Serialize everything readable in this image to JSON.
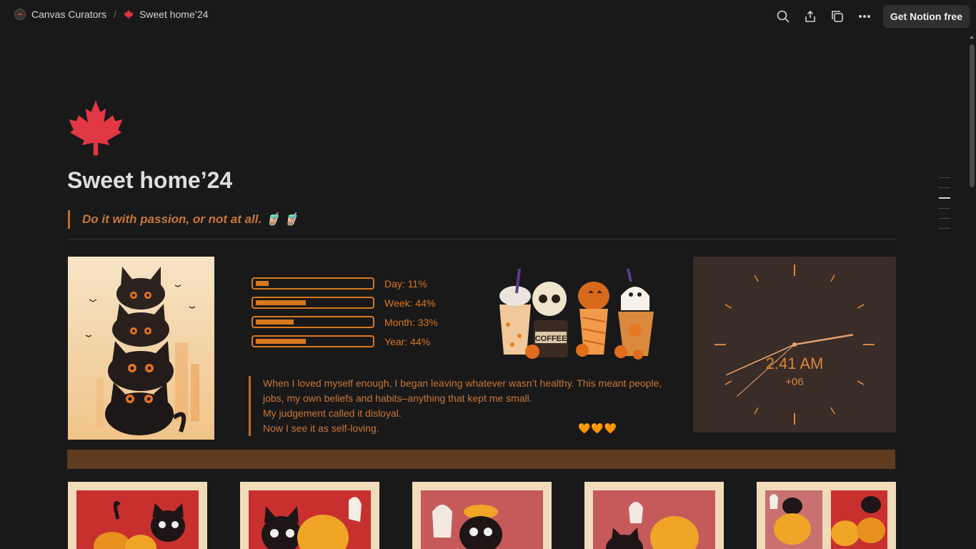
{
  "breadcrumb": {
    "workspace": "Canvas Curators",
    "separator": "/",
    "page": "Sweet home’24"
  },
  "topbar": {
    "icons": [
      "search-icon",
      "share-icon",
      "duplicate-icon",
      "more-icon"
    ],
    "get_button": "Get Notion free"
  },
  "page": {
    "title": "Sweet home’24",
    "quote": "Do it with passion, or not at all. 🧋 🧋"
  },
  "progress": [
    {
      "label": "Day: 11%",
      "value": 0.11
    },
    {
      "label": "Week: 44%",
      "value": 0.44
    },
    {
      "label": "Month: 33%",
      "value": 0.33
    },
    {
      "label": "Year: 44%",
      "value": 0.44
    }
  ],
  "reflection": {
    "lines": [
      "When I loved myself enough, I began leaving whatever wasn’t healthy. This meant people, jobs, my own beliefs and habits–anything that kept me small.",
      "My judgement called it disloyal.",
      "Now I see it as self-loving."
    ],
    "hearts": "🧡🧡🧡"
  },
  "clock": {
    "time": "2:41 AM",
    "timezone": "+06"
  },
  "colors": {
    "accent": "#d8771f",
    "quote": "#c9763a",
    "banner": "#5f3b1f",
    "clock_bg": "#3a2c26",
    "leaf": "#e23744"
  }
}
